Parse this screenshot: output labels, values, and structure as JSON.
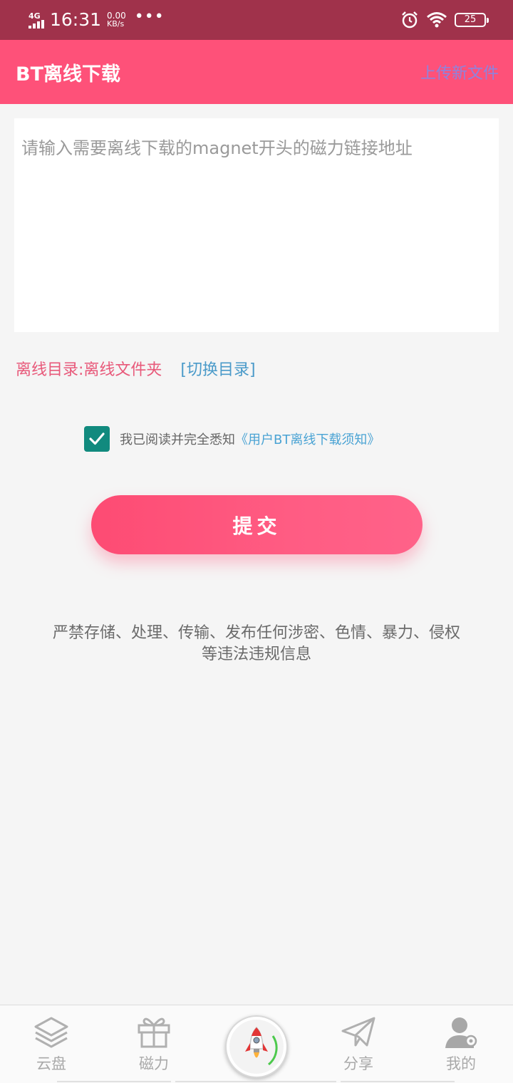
{
  "status_bar": {
    "network": "4G",
    "time": "16:31",
    "speed_value": "0.00",
    "speed_unit": "KB/s",
    "more": "•••",
    "battery": "25",
    "icons": [
      "signal-icon",
      "alarm-icon",
      "wifi-icon",
      "battery-icon"
    ]
  },
  "app_bar": {
    "title": "BT离线下载",
    "upload_link": "上传新文件"
  },
  "magnet_input": {
    "placeholder": "请输入需要离线下载的magnet开头的磁力链接地址",
    "value": ""
  },
  "directory": {
    "label": "离线目录:离线文件夹",
    "switch_link": "[切换目录]"
  },
  "agreement": {
    "checked": true,
    "text": "我已阅读并完全悉知",
    "link": "《用户BT离线下载须知》"
  },
  "submit": {
    "label": "提交"
  },
  "warning": {
    "line1": "严禁存储、处理、传输、发布任何涉密、色情、暴力、侵权",
    "line2": "等违法违规信息"
  },
  "bottom_nav": {
    "items": [
      {
        "label": "云盘",
        "icon": "layers-icon"
      },
      {
        "label": "磁力",
        "icon": "gift-icon"
      },
      {
        "label": "",
        "icon": "rocket-icon"
      },
      {
        "label": "分享",
        "icon": "paper-plane-icon"
      },
      {
        "label": "我的",
        "icon": "user-icon"
      }
    ]
  },
  "colors": {
    "status_bar": "#a0324b",
    "app_bar": "#fe5179",
    "accent_pink": "#e8597a",
    "link_blue": "#4a9ac9",
    "checkbox": "#118a7e",
    "background": "#f5f5f5"
  }
}
